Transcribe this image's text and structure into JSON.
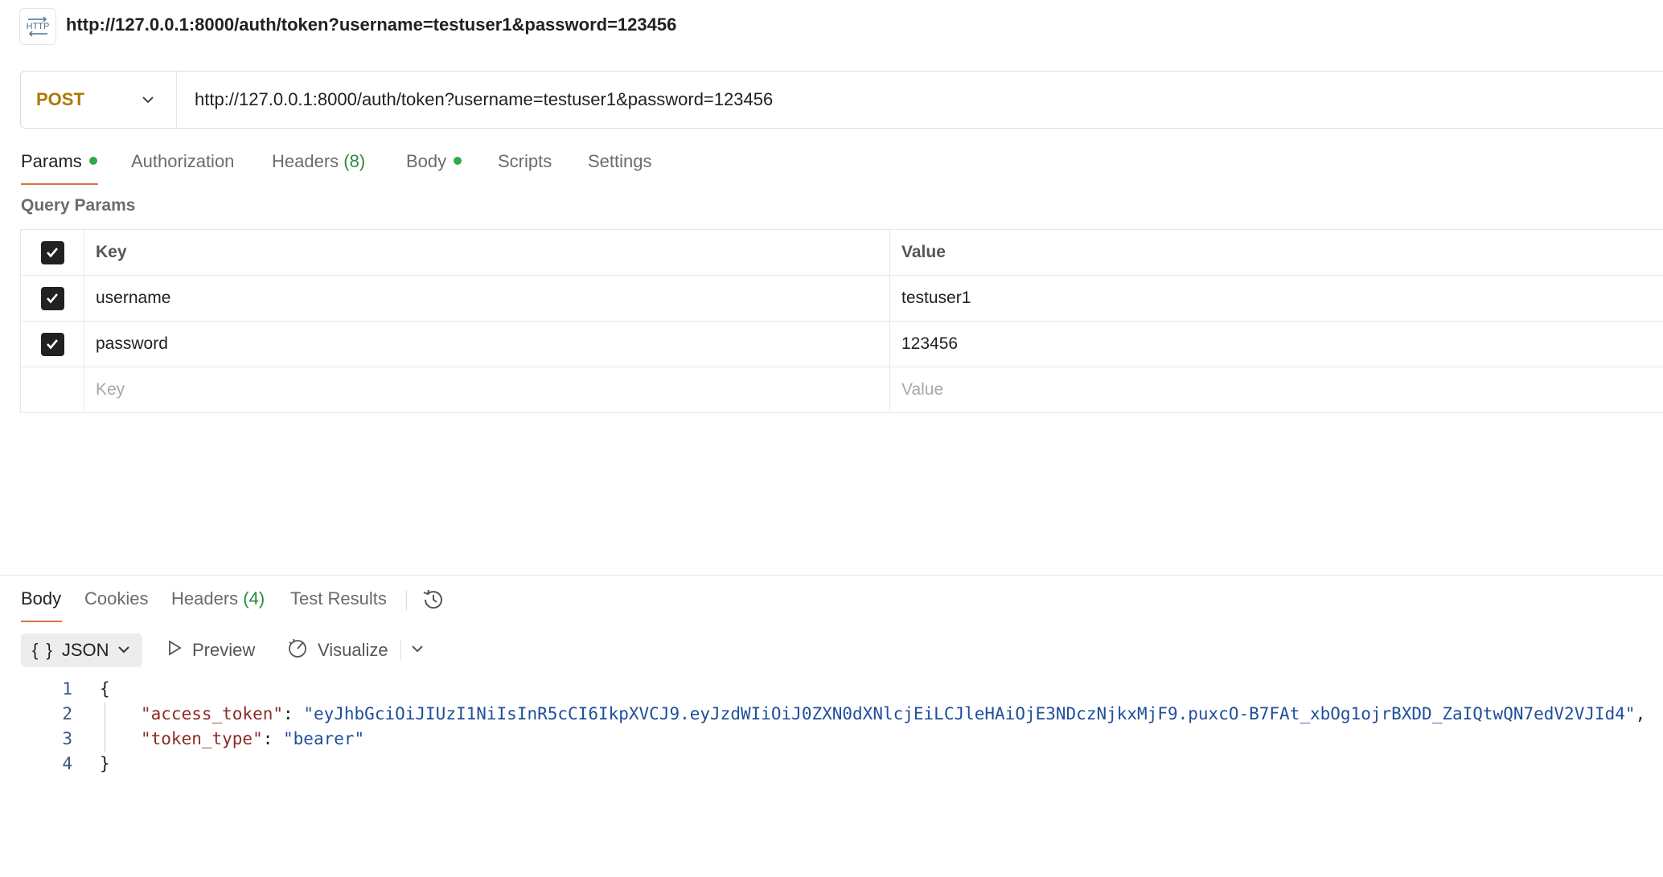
{
  "header": {
    "icon": "http-icon",
    "title": "http://127.0.0.1:8000/auth/token?username=testuser1&password=123456"
  },
  "request": {
    "method": "POST",
    "url": "http://127.0.0.1:8000/auth/token?username=testuser1&password=123456",
    "tabs": [
      {
        "label": "Params",
        "dot": true,
        "active": true
      },
      {
        "label": "Authorization"
      },
      {
        "label": "Headers",
        "count": "(8)"
      },
      {
        "label": "Body",
        "dot": true
      },
      {
        "label": "Scripts"
      },
      {
        "label": "Settings"
      }
    ],
    "section_title": "Query Params",
    "params_table": {
      "headers": {
        "key": "Key",
        "value": "Value"
      },
      "rows": [
        {
          "checked": true,
          "key": "username",
          "value": "testuser1"
        },
        {
          "checked": true,
          "key": "password",
          "value": "123456"
        }
      ],
      "placeholder": {
        "key": "Key",
        "value": "Value"
      }
    }
  },
  "response": {
    "tabs": [
      {
        "label": "Body",
        "active": true
      },
      {
        "label": "Cookies"
      },
      {
        "label": "Headers",
        "count": "(4)"
      },
      {
        "label": "Test Results"
      }
    ],
    "format": {
      "label": "JSON",
      "preview": "Preview",
      "visualize": "Visualize"
    },
    "code_lines": [
      {
        "n": "1",
        "text": "{"
      },
      {
        "n": "2",
        "key": "\"access_token\"",
        "value": "\"eyJhbGciOiJIUzI1NiIsInR5cCI6IkpXVCJ9.eyJzdWIiOiJ0ZXN0dXNlcjEiLCJleHAiOjE3NDczNjkxMjF9.puxcO-B7FAt_xbOg1ojrBXDD_ZaIQtwQN7edV2VJId4\"",
        "trail": ","
      },
      {
        "n": "3",
        "key": "\"token_type\"",
        "value": "\"bearer\"",
        "trail": ""
      },
      {
        "n": "4",
        "text": "}"
      }
    ]
  },
  "colors": {
    "method": "#ad7a03",
    "active_tab_underline": "#e07040",
    "dot": "#2faa4b",
    "json_key": "#8b2c24",
    "json_string": "#1f4f9a"
  }
}
